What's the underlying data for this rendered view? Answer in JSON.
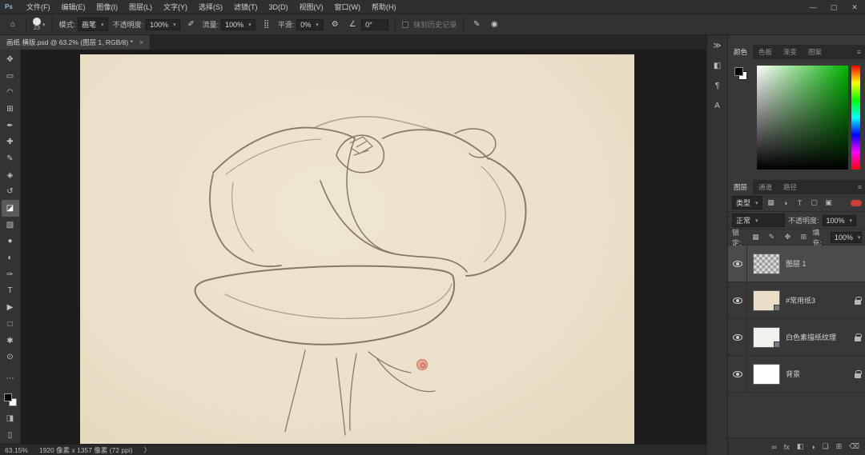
{
  "app": {
    "logo": "Ps"
  },
  "menu": {
    "items": [
      "文件(F)",
      "编辑(E)",
      "图像(I)",
      "图层(L)",
      "文字(Y)",
      "选择(S)",
      "滤镜(T)",
      "3D(D)",
      "视图(V)",
      "窗口(W)",
      "帮助(H)"
    ]
  },
  "window_controls": {
    "minimize": "—",
    "maximize": "▢",
    "close": "✕"
  },
  "options_bar": {
    "home_icon": "⌂",
    "brush_size": "23",
    "mode_label": "模式:",
    "mode_value": "画笔",
    "opacity_label": "不透明度:",
    "opacity_value": "100%",
    "pressure_icon": "✐",
    "flow_label": "流量:",
    "flow_value": "100%",
    "airbrush_icon": "⣿",
    "smooth_label": "平滑:",
    "smooth_value": "0%",
    "gear_icon": "⚙",
    "angle_icon": "∠",
    "angle_value": "0°",
    "erase_history_label": "抹到历史记录",
    "brush_panel_icon": "✎",
    "pressure_toggle_icon": "◉"
  },
  "document_tab": {
    "title": "画纸 横版.psd @ 63.2% (图层 1, RGB/8) *",
    "close": "×"
  },
  "tools": {
    "items": [
      {
        "name": "move-tool",
        "glyph": "✥"
      },
      {
        "name": "marquee-tool",
        "glyph": "▭"
      },
      {
        "name": "lasso-tool",
        "glyph": "◠"
      },
      {
        "name": "crop-tool",
        "glyph": "⊞"
      },
      {
        "name": "eyedropper-tool",
        "glyph": "✒"
      },
      {
        "name": "healing-brush-tool",
        "glyph": "✚"
      },
      {
        "name": "brush-tool",
        "glyph": "✎"
      },
      {
        "name": "clone-stamp-tool",
        "glyph": "◈"
      },
      {
        "name": "history-brush-tool",
        "glyph": "↺"
      },
      {
        "name": "eraser-tool",
        "glyph": "◪"
      },
      {
        "name": "gradient-tool",
        "glyph": "▧"
      },
      {
        "name": "blur-tool",
        "glyph": "●"
      },
      {
        "name": "dodge-tool",
        "glyph": "◐"
      },
      {
        "name": "pen-tool",
        "glyph": "✑"
      },
      {
        "name": "type-tool",
        "glyph": "T"
      },
      {
        "name": "path-select-tool",
        "glyph": "▶"
      },
      {
        "name": "shape-tool",
        "glyph": "□"
      },
      {
        "name": "hand-tool",
        "glyph": "✱"
      },
      {
        "name": "zoom-tool",
        "glyph": "⊙"
      }
    ],
    "more_icon": "⋯"
  },
  "status_bar": {
    "zoom": "63.15%",
    "doc_info": "1920 像素 x 1357 像素 (72 ppi)",
    "chevron": "〉"
  },
  "strip": {
    "collapse_icon": "≫",
    "properties_icon": "◧",
    "paragraph_icon": "¶",
    "character_icon": "A"
  },
  "color_panel": {
    "tabs": [
      "颜色",
      "色板",
      "渐变",
      "图案"
    ],
    "menu_icon": "≡",
    "foreground_color": "#000000",
    "background_color": "#ffffff",
    "hue": "#00b400"
  },
  "layers_panel": {
    "tabs": [
      "图层",
      "通道",
      "路径"
    ],
    "menu_icon": "≡",
    "kind_label": "类型",
    "kind_chevron": "▾",
    "filter_icons": [
      "▦",
      "◑",
      "T",
      "▢",
      "▣"
    ],
    "blend_mode": "正常",
    "opacity_label": "不透明度:",
    "opacity_value": "100%",
    "lock_label": "锁定:",
    "lock_icons": [
      "▦",
      "✎",
      "✥",
      "⊞"
    ],
    "fill_label": "填充:",
    "fill_value": "100%",
    "layers": [
      {
        "name": "图层 1",
        "selected": true,
        "locked": false
      },
      {
        "name": "#常用纸3",
        "selected": false,
        "locked": true
      },
      {
        "name": "白色素描纸纹理",
        "selected": false,
        "locked": true
      },
      {
        "name": "背景",
        "selected": false,
        "locked": true
      }
    ],
    "bottom_icons": {
      "link": "∞",
      "effects": "fx",
      "mask": "◧",
      "adjustment": "◑",
      "group": "❏",
      "new_layer": "⊞",
      "delete": "⌫"
    }
  }
}
